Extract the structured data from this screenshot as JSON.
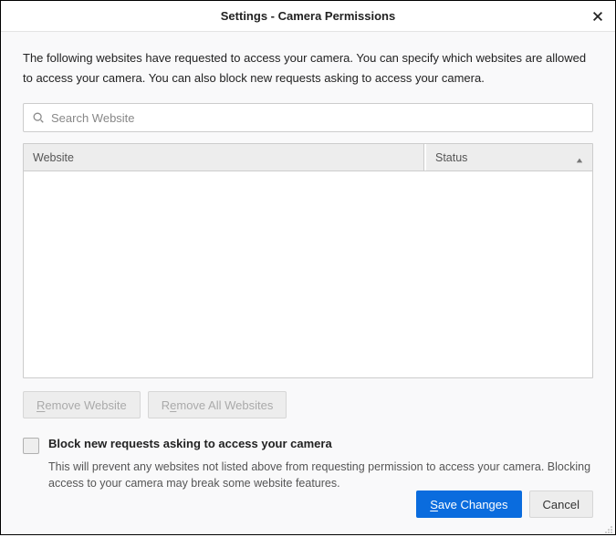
{
  "window": {
    "title": "Settings - Camera Permissions"
  },
  "description": "The following websites have requested to access your camera. You can specify which websites are allowed to access your camera. You can also block new requests asking to access your camera.",
  "search": {
    "placeholder": "Search Website",
    "value": ""
  },
  "table": {
    "columns": {
      "website": "Website",
      "status": "Status"
    },
    "sort": {
      "column": "status",
      "direction": "asc"
    },
    "rows": []
  },
  "buttons": {
    "remove_website": "Remove Website",
    "remove_all": "Remove All Websites",
    "save": "Save Changes",
    "cancel": "Cancel"
  },
  "block_option": {
    "checked": false,
    "label": "Block new requests asking to access your camera",
    "description": "This will prevent any websites not listed above from requesting permission to access your camera. Blocking access to your camera may break some website features."
  }
}
